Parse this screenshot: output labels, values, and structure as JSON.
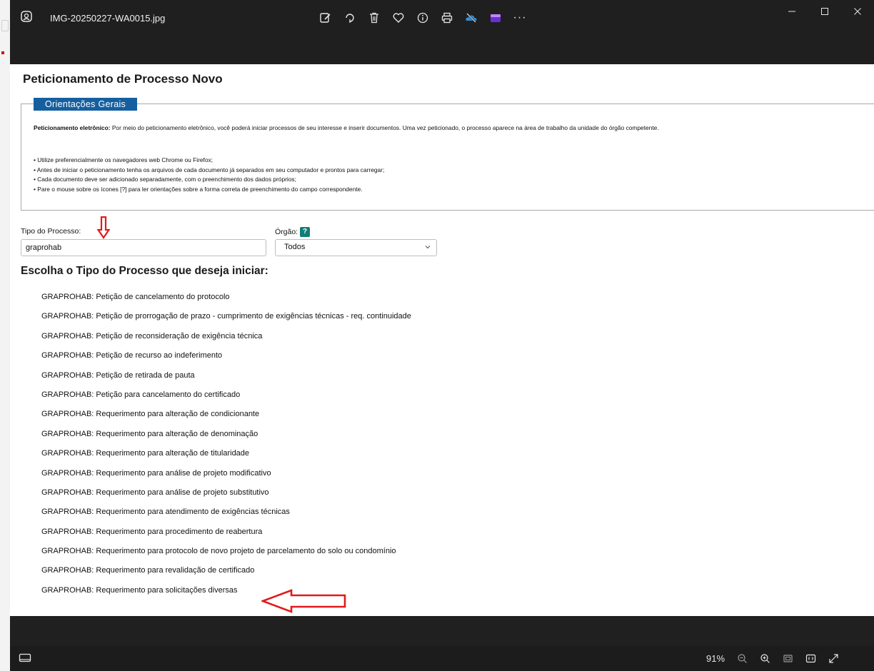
{
  "viewer": {
    "filename": "IMG-20250227-WA0015.jpg",
    "more_label": "···",
    "toolbar_icons": [
      "edit-image-icon",
      "rotate-icon",
      "delete-icon",
      "favorite-icon",
      "info-icon",
      "print-icon",
      "onedrive-offline-icon",
      "clipchamp-icon",
      "more-icon"
    ],
    "zoom_label": "91%"
  },
  "page": {
    "title": "Peticionamento de Processo Novo",
    "legend": "Orientações Gerais",
    "intro_bold": "Peticionamento eletrônico:",
    "intro_text": " Por meio do peticionamento eletrônico, você poderá iniciar processos de seu interesse e inserir documentos. Uma vez peticionado, o processo aparece na área de trabalho da unidade do órgão competente.",
    "bullets": [
      "• Utilize preferencialmente os navegadores web Chrome ou Firefox;",
      "• Antes de iniciar o peticionamento tenha os arquivos de cada documento já separados em seu computador e prontos para carregar;",
      "• Cada documento deve ser adicionado separadamente, com o preenchimento dos dados próprios;",
      "• Pare o mouse sobre os ícones [?] para ler orientações sobre a forma correta de preenchimento do campo correspondente."
    ],
    "tipo_label": "Tipo do Processo:",
    "tipo_value": "graprohab",
    "orgao_label": "Órgão:",
    "orgao_help": "?",
    "orgao_value": "Todos",
    "section_heading": "Escolha o Tipo do Processo que deseja iniciar:",
    "process_types": [
      "GRAPROHAB: Petição de cancelamento do protocolo",
      "GRAPROHAB: Petição de prorrogação de prazo - cumprimento de exigências técnicas - req. continuidade",
      "GRAPROHAB: Petição de reconsideração de exigência técnica",
      "GRAPROHAB: Petição de recurso ao indeferimento",
      "GRAPROHAB: Petição de retirada de pauta",
      "GRAPROHAB: Petição para cancelamento do certificado",
      "GRAPROHAB: Requerimento para alteração de condicionante",
      "GRAPROHAB: Requerimento para alteração de denominação",
      "GRAPROHAB: Requerimento para alteração de titularidade",
      "GRAPROHAB: Requerimento para análise de projeto modificativo",
      "GRAPROHAB: Requerimento para análise de projeto substitutivo",
      "GRAPROHAB: Requerimento para atendimento de exigências técnicas",
      "GRAPROHAB: Requerimento para procedimento de reabertura",
      "GRAPROHAB: Requerimento para protocolo de novo projeto de parcelamento do solo ou condomínio",
      "GRAPROHAB: Requerimento para revalidação de certificado",
      "GRAPROHAB: Requerimento para solicitações diversas"
    ]
  },
  "colors": {
    "legend_bg": "#155f9f",
    "help_badge": "#137d77",
    "annotation_arrow": "#e01b1b",
    "viewer_bg": "#1f1f1f"
  }
}
